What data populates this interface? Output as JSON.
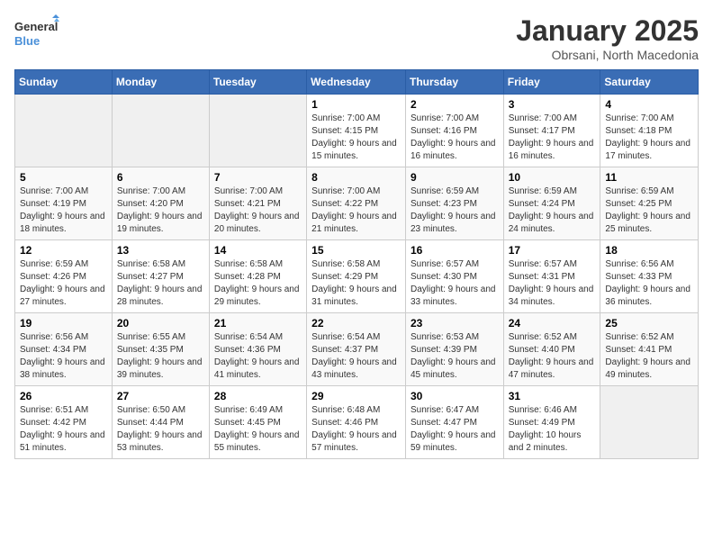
{
  "header": {
    "logo_general": "General",
    "logo_blue": "Blue",
    "title": "January 2025",
    "subtitle": "Obrsani, North Macedonia"
  },
  "weekdays": [
    "Sunday",
    "Monday",
    "Tuesday",
    "Wednesday",
    "Thursday",
    "Friday",
    "Saturday"
  ],
  "weeks": [
    [
      {
        "day": "",
        "sunrise": "",
        "sunset": "",
        "daylight": "",
        "empty": true
      },
      {
        "day": "",
        "sunrise": "",
        "sunset": "",
        "daylight": "",
        "empty": true
      },
      {
        "day": "",
        "sunrise": "",
        "sunset": "",
        "daylight": "",
        "empty": true
      },
      {
        "day": "1",
        "sunrise": "Sunrise: 7:00 AM",
        "sunset": "Sunset: 4:15 PM",
        "daylight": "Daylight: 9 hours and 15 minutes."
      },
      {
        "day": "2",
        "sunrise": "Sunrise: 7:00 AM",
        "sunset": "Sunset: 4:16 PM",
        "daylight": "Daylight: 9 hours and 16 minutes."
      },
      {
        "day": "3",
        "sunrise": "Sunrise: 7:00 AM",
        "sunset": "Sunset: 4:17 PM",
        "daylight": "Daylight: 9 hours and 16 minutes."
      },
      {
        "day": "4",
        "sunrise": "Sunrise: 7:00 AM",
        "sunset": "Sunset: 4:18 PM",
        "daylight": "Daylight: 9 hours and 17 minutes."
      }
    ],
    [
      {
        "day": "5",
        "sunrise": "Sunrise: 7:00 AM",
        "sunset": "Sunset: 4:19 PM",
        "daylight": "Daylight: 9 hours and 18 minutes."
      },
      {
        "day": "6",
        "sunrise": "Sunrise: 7:00 AM",
        "sunset": "Sunset: 4:20 PM",
        "daylight": "Daylight: 9 hours and 19 minutes."
      },
      {
        "day": "7",
        "sunrise": "Sunrise: 7:00 AM",
        "sunset": "Sunset: 4:21 PM",
        "daylight": "Daylight: 9 hours and 20 minutes."
      },
      {
        "day": "8",
        "sunrise": "Sunrise: 7:00 AM",
        "sunset": "Sunset: 4:22 PM",
        "daylight": "Daylight: 9 hours and 21 minutes."
      },
      {
        "day": "9",
        "sunrise": "Sunrise: 6:59 AM",
        "sunset": "Sunset: 4:23 PM",
        "daylight": "Daylight: 9 hours and 23 minutes."
      },
      {
        "day": "10",
        "sunrise": "Sunrise: 6:59 AM",
        "sunset": "Sunset: 4:24 PM",
        "daylight": "Daylight: 9 hours and 24 minutes."
      },
      {
        "day": "11",
        "sunrise": "Sunrise: 6:59 AM",
        "sunset": "Sunset: 4:25 PM",
        "daylight": "Daylight: 9 hours and 25 minutes."
      }
    ],
    [
      {
        "day": "12",
        "sunrise": "Sunrise: 6:59 AM",
        "sunset": "Sunset: 4:26 PM",
        "daylight": "Daylight: 9 hours and 27 minutes."
      },
      {
        "day": "13",
        "sunrise": "Sunrise: 6:58 AM",
        "sunset": "Sunset: 4:27 PM",
        "daylight": "Daylight: 9 hours and 28 minutes."
      },
      {
        "day": "14",
        "sunrise": "Sunrise: 6:58 AM",
        "sunset": "Sunset: 4:28 PM",
        "daylight": "Daylight: 9 hours and 29 minutes."
      },
      {
        "day": "15",
        "sunrise": "Sunrise: 6:58 AM",
        "sunset": "Sunset: 4:29 PM",
        "daylight": "Daylight: 9 hours and 31 minutes."
      },
      {
        "day": "16",
        "sunrise": "Sunrise: 6:57 AM",
        "sunset": "Sunset: 4:30 PM",
        "daylight": "Daylight: 9 hours and 33 minutes."
      },
      {
        "day": "17",
        "sunrise": "Sunrise: 6:57 AM",
        "sunset": "Sunset: 4:31 PM",
        "daylight": "Daylight: 9 hours and 34 minutes."
      },
      {
        "day": "18",
        "sunrise": "Sunrise: 6:56 AM",
        "sunset": "Sunset: 4:33 PM",
        "daylight": "Daylight: 9 hours and 36 minutes."
      }
    ],
    [
      {
        "day": "19",
        "sunrise": "Sunrise: 6:56 AM",
        "sunset": "Sunset: 4:34 PM",
        "daylight": "Daylight: 9 hours and 38 minutes."
      },
      {
        "day": "20",
        "sunrise": "Sunrise: 6:55 AM",
        "sunset": "Sunset: 4:35 PM",
        "daylight": "Daylight: 9 hours and 39 minutes."
      },
      {
        "day": "21",
        "sunrise": "Sunrise: 6:54 AM",
        "sunset": "Sunset: 4:36 PM",
        "daylight": "Daylight: 9 hours and 41 minutes."
      },
      {
        "day": "22",
        "sunrise": "Sunrise: 6:54 AM",
        "sunset": "Sunset: 4:37 PM",
        "daylight": "Daylight: 9 hours and 43 minutes."
      },
      {
        "day": "23",
        "sunrise": "Sunrise: 6:53 AM",
        "sunset": "Sunset: 4:39 PM",
        "daylight": "Daylight: 9 hours and 45 minutes."
      },
      {
        "day": "24",
        "sunrise": "Sunrise: 6:52 AM",
        "sunset": "Sunset: 4:40 PM",
        "daylight": "Daylight: 9 hours and 47 minutes."
      },
      {
        "day": "25",
        "sunrise": "Sunrise: 6:52 AM",
        "sunset": "Sunset: 4:41 PM",
        "daylight": "Daylight: 9 hours and 49 minutes."
      }
    ],
    [
      {
        "day": "26",
        "sunrise": "Sunrise: 6:51 AM",
        "sunset": "Sunset: 4:42 PM",
        "daylight": "Daylight: 9 hours and 51 minutes."
      },
      {
        "day": "27",
        "sunrise": "Sunrise: 6:50 AM",
        "sunset": "Sunset: 4:44 PM",
        "daylight": "Daylight: 9 hours and 53 minutes."
      },
      {
        "day": "28",
        "sunrise": "Sunrise: 6:49 AM",
        "sunset": "Sunset: 4:45 PM",
        "daylight": "Daylight: 9 hours and 55 minutes."
      },
      {
        "day": "29",
        "sunrise": "Sunrise: 6:48 AM",
        "sunset": "Sunset: 4:46 PM",
        "daylight": "Daylight: 9 hours and 57 minutes."
      },
      {
        "day": "30",
        "sunrise": "Sunrise: 6:47 AM",
        "sunset": "Sunset: 4:47 PM",
        "daylight": "Daylight: 9 hours and 59 minutes."
      },
      {
        "day": "31",
        "sunrise": "Sunrise: 6:46 AM",
        "sunset": "Sunset: 4:49 PM",
        "daylight": "Daylight: 10 hours and 2 minutes."
      },
      {
        "day": "",
        "sunrise": "",
        "sunset": "",
        "daylight": "",
        "empty": true
      }
    ]
  ]
}
